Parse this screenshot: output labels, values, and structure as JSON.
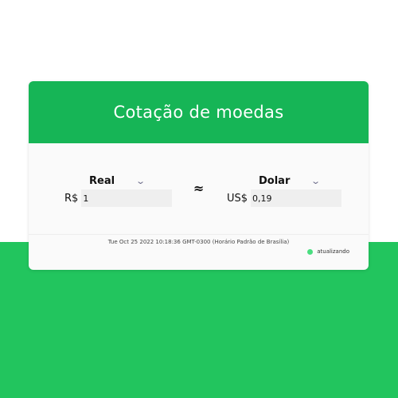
{
  "card": {
    "title": "Cotação de moedas"
  },
  "from": {
    "currency_name": "Real",
    "symbol": "R$",
    "amount": "1"
  },
  "to": {
    "currency_name": "Dolar",
    "symbol": "US$",
    "amount": "0,19"
  },
  "approx_symbol": "≈",
  "icons": {
    "dropdown": "chevron-down-icon",
    "status": "status-dot-icon"
  },
  "timestamp": "Tue Oct 25 2022 10:18:36 GMT-0300 (Horário Padrão de Brasília)",
  "status": {
    "label": "atualizando",
    "color": "#4ade80"
  },
  "colors": {
    "header": "#16b556",
    "background_bottom": "#22c55e"
  }
}
